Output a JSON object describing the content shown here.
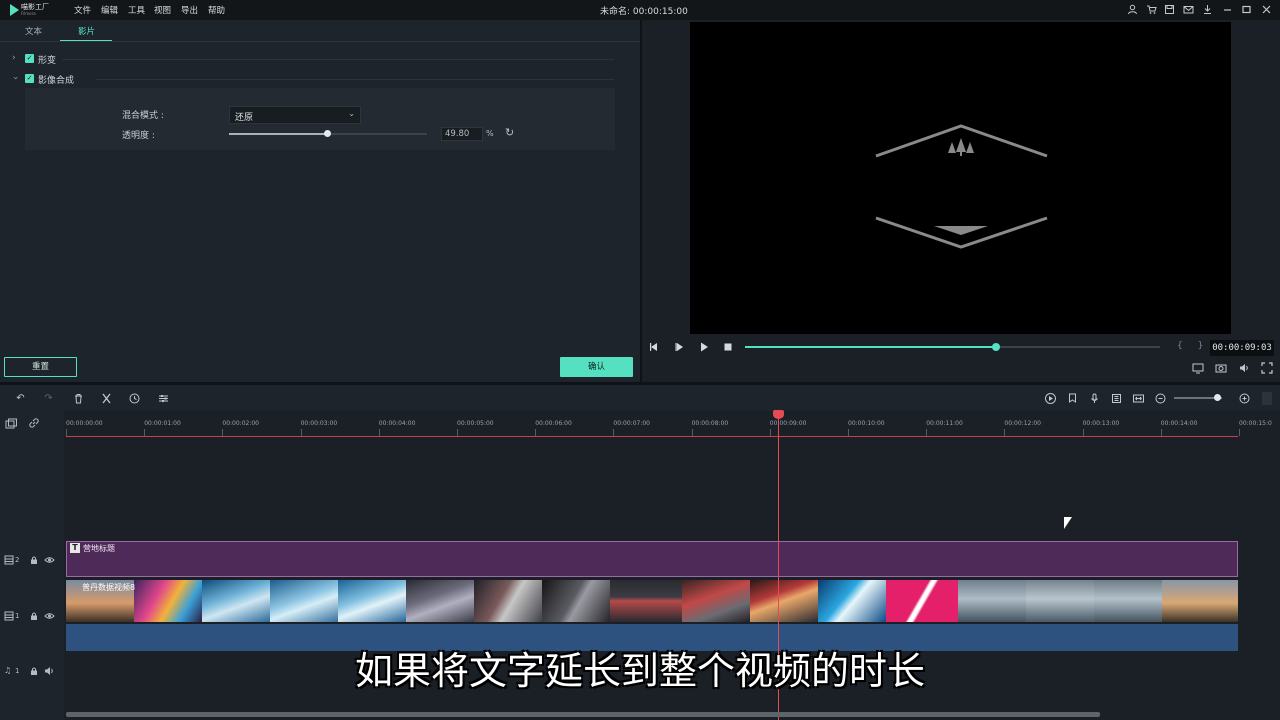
{
  "app": {
    "logo_text": "喵影工厂",
    "logo_sub": "Filmora",
    "document_title": "未命名: 00:00:15:00"
  },
  "menu": [
    "文件",
    "编辑",
    "工具",
    "视图",
    "导出",
    "帮助"
  ],
  "window_icons": [
    "user-icon",
    "cart-icon",
    "save-icon",
    "mail-icon",
    "download-icon",
    "minimize-icon",
    "maximize-icon",
    "close-icon"
  ],
  "editor": {
    "tabs": [
      "文本",
      "影片"
    ],
    "active_tab": "影片",
    "sections": [
      {
        "label": "形变",
        "expanded": false,
        "checked": true
      },
      {
        "label": "影像合成",
        "expanded": true,
        "checked": true
      }
    ],
    "blend_mode_label": "混合模式 :",
    "blend_mode_value": "还原",
    "opacity_label": "透明度 :",
    "opacity_value": "49.80",
    "opacity_unit": "%",
    "opacity_fraction": 0.498,
    "reset_label": "重置",
    "ok_label": "确认"
  },
  "preview": {
    "time": "00:00:09:03",
    "markers": "{ }",
    "progress_fraction": 0.605
  },
  "ruler": {
    "labels": [
      "00:00:00:00",
      "00:00:01:00",
      "00:00:02:00",
      "00:00:03:00",
      "00:00:04:00",
      "00:00:05:00",
      "00:00:06:00",
      "00:00:07:00",
      "00:00:08:00",
      "00:00:09:00",
      "00:00:10:00",
      "00:00:11:00",
      "00:00:12:00",
      "00:00:13:00",
      "00:00:14:00",
      "00:00:15:0"
    ]
  },
  "tracks": {
    "track2_label": "2",
    "track1_label": "1",
    "audio1_label": "1",
    "title_clip_label": "营地标题",
    "video_clip_label": "普丹数据视频8"
  },
  "subtitle": "如果将文字延长到整个视频的时长",
  "colors": {
    "accent": "#55e0c2",
    "playhead": "#e64a55",
    "title_clip": "#4e2a59",
    "audio_clip": "#2e5280"
  }
}
